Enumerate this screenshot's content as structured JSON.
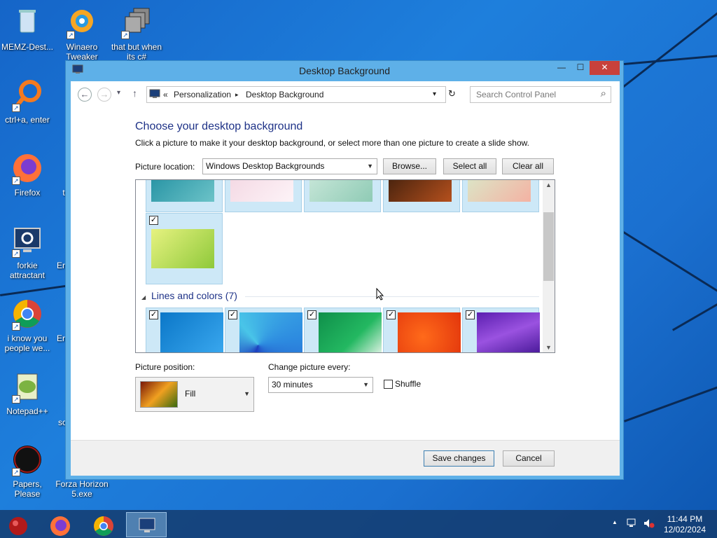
{
  "desktop": {
    "icons": [
      {
        "label": "MEMZ-Dest...",
        "icon": "recycle-bin-icon"
      },
      {
        "label": "Winaero Tweaker",
        "icon": "winaero-icon"
      },
      {
        "label": "that but when its c#",
        "icon": "shortcut-stack-icon"
      },
      {
        "label": "ctrl+a, enter",
        "icon": "magnifier-ring-icon"
      },
      {
        "label": "Firefox",
        "icon": "firefox-icon"
      },
      {
        "label": "forkie attractant",
        "icon": "computer-gear-icon"
      },
      {
        "label": "i know you people we...",
        "icon": "chrome-icon"
      },
      {
        "label": "Notepad++",
        "icon": "notepadpp-icon"
      },
      {
        "label": "Papers, Please",
        "icon": "papers-please-icon"
      },
      {
        "label": "Forza Horizon 5.exe",
        "icon": "blank-icon"
      }
    ],
    "partial_labels": [
      "t",
      "Er",
      "Er",
      "sc"
    ]
  },
  "window": {
    "title": "Desktop Background",
    "minimize_glyph": "—",
    "maximize_glyph": "☐",
    "close_glyph": "✕"
  },
  "nav": {
    "back_glyph": "←",
    "forward_glyph": "→",
    "dropdown_glyph": "▾",
    "up_glyph": "↑",
    "chevrons": "«",
    "crumb1": "Personalization",
    "separator": "▸",
    "crumb2": "Desktop Background",
    "refresh_glyph": "↻",
    "search_placeholder": "Search Control Panel",
    "search_glyph": "⌕"
  },
  "main": {
    "heading": "Choose your desktop background",
    "description": "Click a picture to make it your desktop background, or select more than one picture to create a slide show.",
    "picture_location_label": "Picture location:",
    "picture_location_value": "Windows Desktop Backgrounds",
    "browse_label": "Browse...",
    "select_all_label": "Select all",
    "clear_all_label": "Clear all",
    "section_label": "Lines and colors (7)",
    "section_glyph": "◢",
    "check_glyph": "✓",
    "picture_position_label": "Picture position:",
    "picture_position_value": "Fill",
    "change_every_label": "Change picture every:",
    "change_every_value": "30 minutes",
    "shuffle_label": "Shuffle"
  },
  "footer": {
    "save_label": "Save changes",
    "cancel_label": "Cancel"
  },
  "taskbar": {
    "time": "11:44 PM",
    "date": "12/02/2024",
    "tray_up_glyph": "▲"
  },
  "colors": {
    "accent": "#1e3287",
    "titlebar": "#5eb0e8",
    "close": "#c8413b"
  }
}
